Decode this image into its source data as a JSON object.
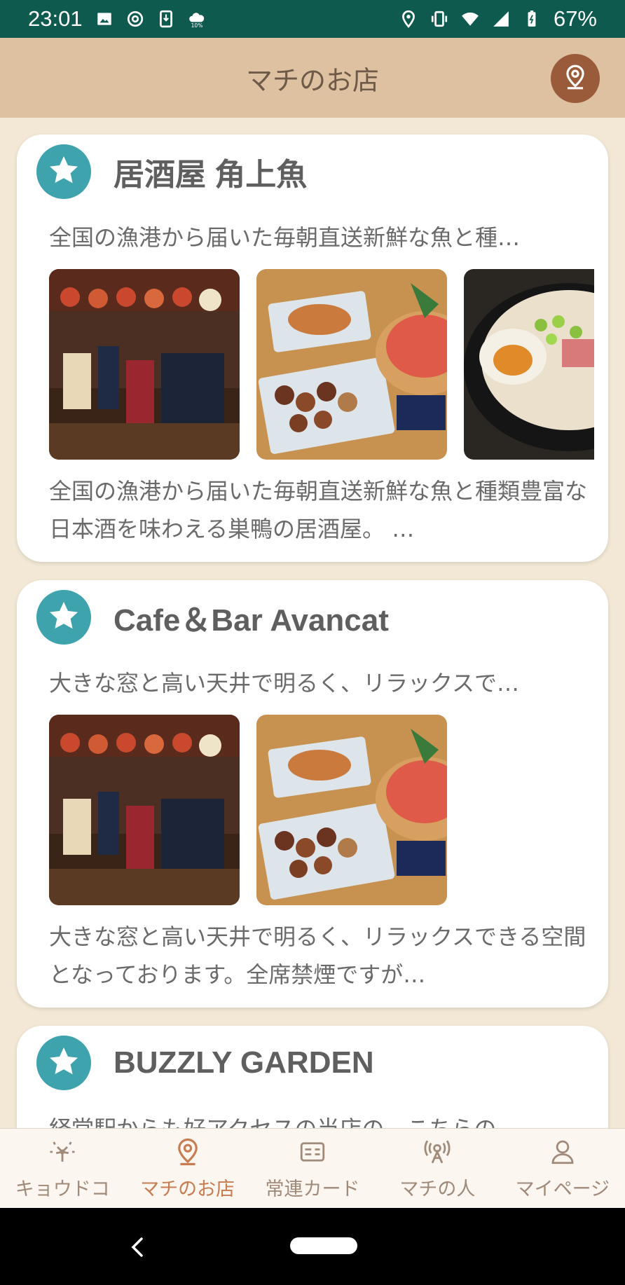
{
  "status_bar": {
    "time": "23:01",
    "battery": "67%",
    "icons": [
      "image-icon",
      "at-icon",
      "download-icon",
      "cloud-icon",
      "location-icon",
      "vibrate-icon",
      "wifi-icon",
      "signal-icon",
      "battery-icon"
    ]
  },
  "app_bar": {
    "title": "マチのお店",
    "action_icon": "location-pin-icon"
  },
  "shops": [
    {
      "title": "居酒屋 角上魚",
      "summary": "全国の漁港から届いた毎朝直送新鮮な魚と種…",
      "description": "全国の漁港から届いた毎朝直送新鮮な魚と種類豊富な日本酒を味わえる巣鴨の居酒屋。 …",
      "photos": [
        "izakaya-interior",
        "yakitori-sashimi",
        "ramen"
      ]
    },
    {
      "title": "Cafe＆Bar Avancat",
      "summary": "大きな窓と高い天井で明るく、リラックスで…",
      "description": "大きな窓と高い天井で明るく、リラックスできる空間となっております。全席禁煙ですが…",
      "photos": [
        "izakaya-interior",
        "yakitori-sashimi"
      ]
    },
    {
      "title": "BUZZLY GARDEN",
      "summary": "経堂駅からも好アクセスの当店の、こちらの…",
      "description": "",
      "photos": []
    }
  ],
  "bottom_nav": [
    {
      "label": "キョウドコ",
      "icon": "fireworks-icon",
      "active": false
    },
    {
      "label": "マチのお店",
      "icon": "location-pin-icon",
      "active": true
    },
    {
      "label": "常連カード",
      "icon": "card-icon",
      "active": false
    },
    {
      "label": "マチの人",
      "icon": "broadcast-person-icon",
      "active": false
    },
    {
      "label": "マイページ",
      "icon": "person-icon",
      "active": false
    }
  ],
  "colors": {
    "status_bar": "#0f5a4f",
    "app_bar": "#dec1a0",
    "background": "#f2e8d5",
    "star_badge": "#3fa3ae",
    "location_button": "#9a5b3a",
    "nav_active": "#c77c52",
    "nav_inactive": "#a08a79"
  }
}
